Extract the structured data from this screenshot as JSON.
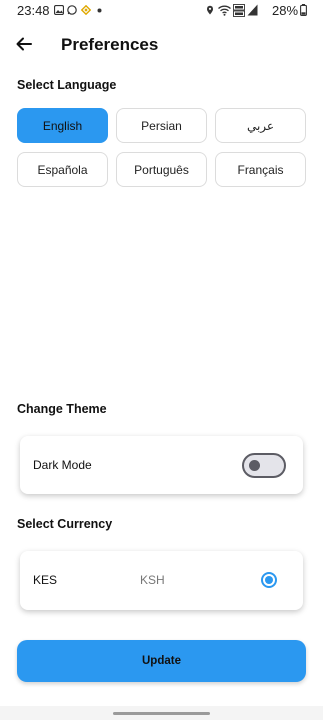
{
  "status_bar": {
    "time": "23:48",
    "battery": "28%",
    "icons": [
      "gallery-icon",
      "whatsapp-icon",
      "binance-icon",
      "dot-icon",
      "location-icon",
      "wifi-icon",
      "volte-icon",
      "signal-icon",
      "battery-icon"
    ]
  },
  "header": {
    "title": "Preferences",
    "back_icon": "arrow-left-icon"
  },
  "language": {
    "title": "Select Language",
    "options": [
      "English",
      "Persian",
      "عربي",
      "Española",
      "Português",
      "Français"
    ],
    "selected": "English"
  },
  "theme": {
    "title": "Change Theme",
    "dark_mode_label": "Dark Mode",
    "dark_mode_on": false
  },
  "currency": {
    "title": "Select Currency",
    "code": "KES",
    "symbol": "KSH",
    "selected": true
  },
  "update_label": "Update",
  "colors": {
    "accent": "#2b98f0",
    "border": "#dcdcdc",
    "toggle_track": "#e4e4ea",
    "toggle_knob": "#5c5c64"
  }
}
